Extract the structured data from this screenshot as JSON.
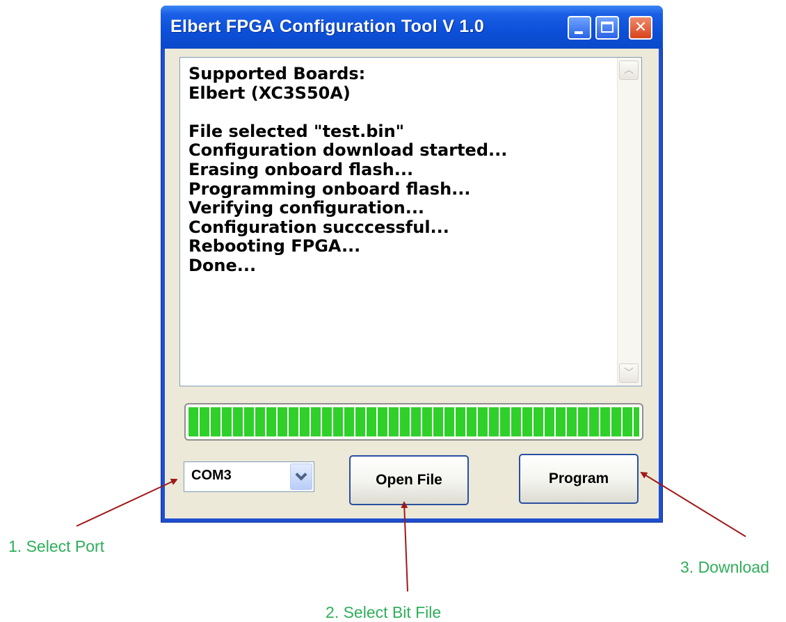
{
  "window": {
    "title": "Elbert FPGA Configuration Tool V 1.0",
    "minimize_glyph": "",
    "close_glyph": "✕"
  },
  "log": {
    "lines": [
      "Supported Boards:",
      "Elbert (XC3S50A)",
      "",
      "File selected \"test.bin\"",
      "Configuration download started...",
      "Erasing onboard flash...",
      "Programming onboard flash...",
      "Verifying configuration...",
      "Configuration succcessful...",
      "Rebooting FPGA...",
      "Done..."
    ],
    "scroll_up_glyph": "︿",
    "scroll_down_glyph": "﹀"
  },
  "progress": {
    "fraction": 1.0,
    "color": "#2fd02a"
  },
  "port": {
    "selected": "COM3"
  },
  "buttons": {
    "open_file": "Open File",
    "program": "Program"
  },
  "annotations": {
    "select_port": "1. Select Port",
    "select_bit_file": "2. Select Bit File",
    "download": "3. Download",
    "text_color": "#2fae5a",
    "arrow_color": "#a01818"
  },
  "colors": {
    "title_bar": "#0c4fd8",
    "window_bg": "#ece9d8",
    "close_button": "#d8431c"
  }
}
